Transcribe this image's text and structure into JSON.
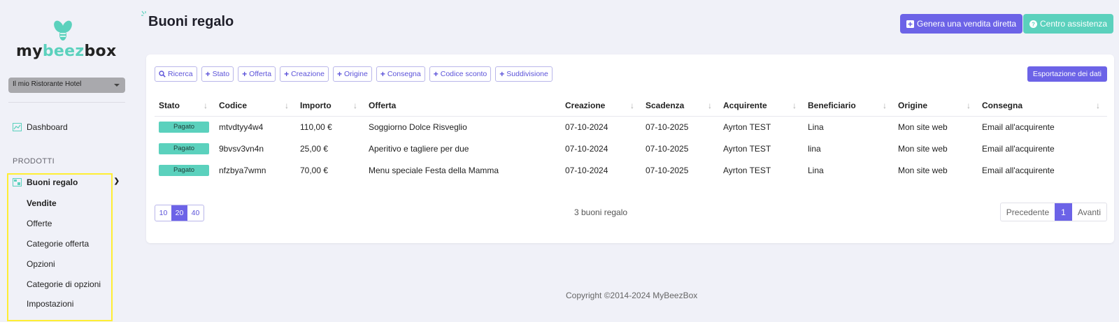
{
  "brand": {
    "logo_left": "my",
    "logo_mid": "beez",
    "logo_right": "box",
    "accent": "#6c63e7",
    "teal": "#5bd1bd",
    "highlight": "#ffee33"
  },
  "sidebar": {
    "establishment": "Il mio Ristorante Hotel",
    "dashboard": "Dashboard",
    "section": "PRODOTTI",
    "gift_vouchers": "Buoni regalo",
    "subitems": [
      "Vendite",
      "Offerte",
      "Categorie offerta",
      "Opzioni",
      "Categorie di opzioni",
      "Impostazioni"
    ]
  },
  "header": {
    "title": "Buoni regalo",
    "direct_sale": "Genera una vendita diretta",
    "help_center": "Centro assistenza"
  },
  "filters": [
    "Ricerca",
    "Stato",
    "Offerta",
    "Creazione",
    "Origine",
    "Consegna",
    "Codice sconto",
    "Suddivisione"
  ],
  "export": "Esportazione dei dati",
  "table": {
    "columns": [
      "Stato",
      "Codice",
      "Importo",
      "Offerta",
      "Creazione",
      "Scadenza",
      "Acquirente",
      "Beneficiario",
      "Origine",
      "Consegna"
    ],
    "rows": [
      [
        "Pagato",
        "mtvdtyy4w4",
        "110,00 €",
        "Soggiorno Dolce Risveglio",
        "07-10-2024",
        "07-10-2025",
        "Ayrton TEST",
        "Lina",
        "Mon site web",
        "Email all'acquirente"
      ],
      [
        "Pagato",
        "9bvsv3vn4n",
        "25,00 €",
        "Aperitivo e tagliere per due",
        "07-10-2024",
        "07-10-2025",
        "Ayrton TEST",
        "lina",
        "Mon site web",
        "Email all'acquirente"
      ],
      [
        "Pagato",
        "nfzbya7wmn",
        "70,00 €",
        "Menu speciale Festa della Mamma",
        "07-10-2024",
        "07-10-2025",
        "Ayrton TEST",
        "Lina",
        "Mon site web",
        "Email all'acquirente"
      ]
    ]
  },
  "page_sizes": [
    "10",
    "20",
    "40"
  ],
  "page_size_selected": "20",
  "count_text": "3 buoni regalo",
  "pagination": {
    "prev": "Precedente",
    "current": "1",
    "next": "Avanti"
  },
  "footer": "Copyright ©2014-2024 MyBeezBox"
}
